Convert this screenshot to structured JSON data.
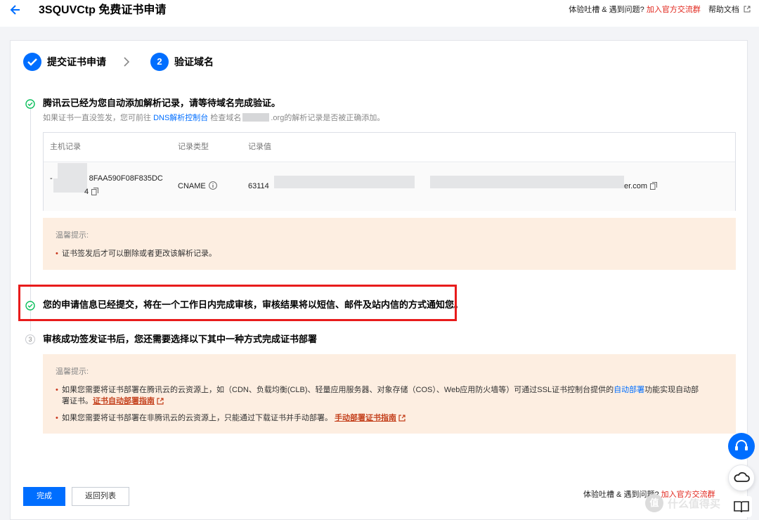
{
  "header": {
    "title": "3SQUVCtp 免费证书申请",
    "feedback": "体验吐槽 & 遇到问题?",
    "join_group": "加入官方交流群",
    "help_docs": "帮助文档"
  },
  "steps": [
    {
      "label": "提交证书申请"
    },
    {
      "number": "2",
      "label": "验证域名"
    }
  ],
  "section1": {
    "title": "腾讯云已经为您自动添加解析记录，请等待域名完成验证。",
    "hint_prefix": "如果证书一直没签发，您可前往",
    "hint_link": "DNS解析控制台",
    "hint_mid": "检查域名",
    "hint_domain_suffix": ".org",
    "hint_suffix": "的解析记录是否被正确添加。"
  },
  "table": {
    "headers": [
      "主机记录",
      "记录类型",
      "记录值"
    ],
    "row": {
      "host_visible": "8FAA590F08F835DC",
      "host_prefix": "-",
      "host_line2_end": "4",
      "type": "CNAME",
      "value_prefix": "63114",
      "value_suffix": "er.com"
    }
  },
  "tip1": {
    "heading": "温馨提示:",
    "items": [
      "证书签发后才可以删除或者更改该解析记录。"
    ]
  },
  "section2": {
    "title": "您的申请信息已经提交，将在一个工作日内完成审核，审核结果将以短信、邮件及站内信的方式通知您。"
  },
  "section3": {
    "number": "3",
    "title": "审核成功签发证书后，您还需要选择以下其中一种方式完成证书部署"
  },
  "tip2": {
    "heading": "温馨提示:",
    "item1_line1": "如果您需要将证书部署在腾讯云的云资源上，如（CDN、负载均衡(CLB)、轻量应用服务器、对象存储（COS）、Web应用防火墙等）可通过SSL证书控制台提供的",
    "item1_link": "自动部署",
    "item1_line1_end": "功能实现自动部",
    "item1_line2": "署证书。",
    "item1_guide": "证书自动部署指南",
    "item2_text": "如果您需要将证书部署在非腾讯云的云资源上，只能通过下载证书并手动部署。",
    "item2_guide": "手动部署证书指南"
  },
  "footer": {
    "done": "完成",
    "back_list": "返回列表",
    "feedback": "体验吐槽 & 遇到问题?",
    "join_group": "加入官方交流群"
  },
  "watermark": {
    "mark": "值",
    "text": "什么值得买"
  },
  "colors": {
    "primary": "#006eff",
    "success": "#0abf5b",
    "warning_bg": "#fdeee1",
    "highlight": "#e81b1b",
    "link_red": "#e1251b"
  }
}
